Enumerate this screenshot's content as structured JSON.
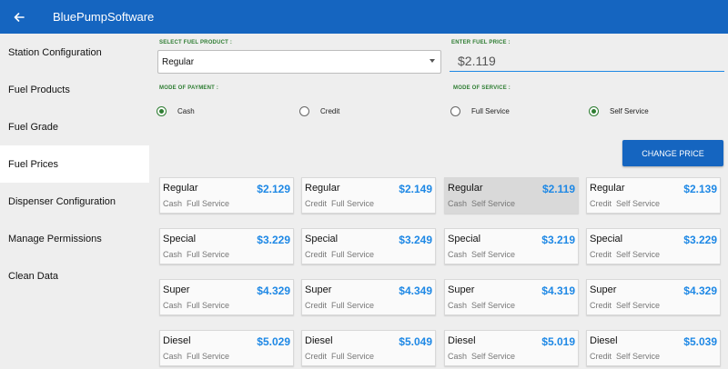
{
  "appbar": {
    "title": "BluePumpSoftware",
    "back_icon": "arrow-left-icon",
    "color": "#1565c0"
  },
  "sidebar": {
    "items": [
      {
        "label": "Station Configuration"
      },
      {
        "label": "Fuel Products"
      },
      {
        "label": "Fuel Grade"
      },
      {
        "label": "Fuel Prices",
        "active": true
      },
      {
        "label": "Dispenser Configuration"
      },
      {
        "label": "Manage Permissions"
      },
      {
        "label": "Clean Data"
      }
    ]
  },
  "form": {
    "select_product_label": "SELECT FUEL PRODUCT :",
    "select_product_value": "Regular",
    "price_label": "ENTER FUEL PRICE :",
    "price_value": "$2.119",
    "payment_label": "MODE OF PAYMENT :",
    "payment_options": [
      {
        "label": "Cash",
        "checked": true
      },
      {
        "label": "Credit",
        "checked": false
      }
    ],
    "service_label": "MODE OF SERVICE :",
    "service_options": [
      {
        "label": "Full Service",
        "checked": false
      },
      {
        "label": "Self Service",
        "checked": true
      }
    ],
    "change_button": "CHANGE PRICE"
  },
  "price_cards": [
    {
      "fuel": "Regular",
      "price": "$2.129",
      "payment": "Cash",
      "service": "Full Service"
    },
    {
      "fuel": "Regular",
      "price": "$2.149",
      "payment": "Credit",
      "service": "Full Service"
    },
    {
      "fuel": "Regular",
      "price": "$2.119",
      "payment": "Cash",
      "service": "Self Service",
      "selected": true
    },
    {
      "fuel": "Regular",
      "price": "$2.139",
      "payment": "Credit",
      "service": "Self Service"
    },
    {
      "fuel": "Special",
      "price": "$3.229",
      "payment": "Cash",
      "service": "Full Service"
    },
    {
      "fuel": "Special",
      "price": "$3.249",
      "payment": "Credit",
      "service": "Full Service"
    },
    {
      "fuel": "Special",
      "price": "$3.219",
      "payment": "Cash",
      "service": "Self Service"
    },
    {
      "fuel": "Special",
      "price": "$3.229",
      "payment": "Credit",
      "service": "Self Service"
    },
    {
      "fuel": "Super",
      "price": "$4.329",
      "payment": "Cash",
      "service": "Full Service"
    },
    {
      "fuel": "Super",
      "price": "$4.349",
      "payment": "Credit",
      "service": "Full Service"
    },
    {
      "fuel": "Super",
      "price": "$4.319",
      "payment": "Cash",
      "service": "Self Service"
    },
    {
      "fuel": "Super",
      "price": "$4.329",
      "payment": "Credit",
      "service": "Self Service"
    },
    {
      "fuel": "Diesel",
      "price": "$5.029",
      "payment": "Cash",
      "service": "Full Service"
    },
    {
      "fuel": "Diesel",
      "price": "$5.049",
      "payment": "Credit",
      "service": "Full Service"
    },
    {
      "fuel": "Diesel",
      "price": "$5.019",
      "payment": "Cash",
      "service": "Self Service"
    },
    {
      "fuel": "Diesel",
      "price": "$5.039",
      "payment": "Credit",
      "service": "Self Service"
    }
  ]
}
